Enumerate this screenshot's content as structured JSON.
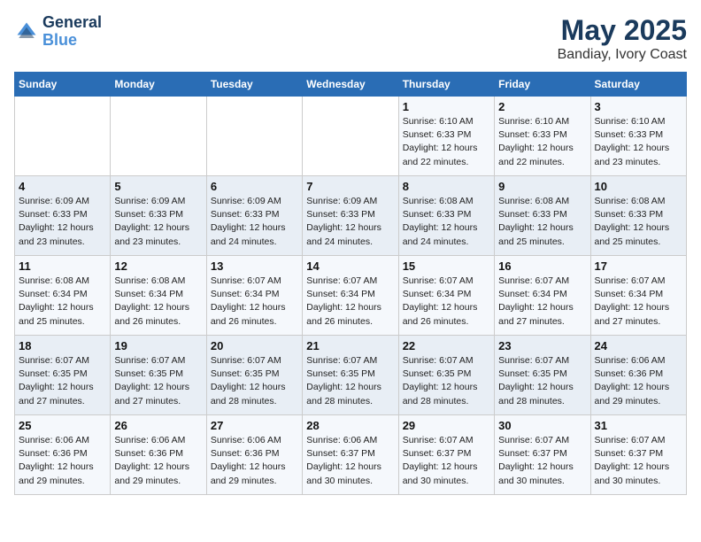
{
  "header": {
    "logo_line1": "General",
    "logo_line2": "Blue",
    "month_title": "May 2025",
    "location": "Bandiay, Ivory Coast"
  },
  "weekdays": [
    "Sunday",
    "Monday",
    "Tuesday",
    "Wednesday",
    "Thursday",
    "Friday",
    "Saturday"
  ],
  "weeks": [
    [
      {
        "day": "",
        "info": ""
      },
      {
        "day": "",
        "info": ""
      },
      {
        "day": "",
        "info": ""
      },
      {
        "day": "",
        "info": ""
      },
      {
        "day": "1",
        "info": "Sunrise: 6:10 AM\nSunset: 6:33 PM\nDaylight: 12 hours\nand 22 minutes."
      },
      {
        "day": "2",
        "info": "Sunrise: 6:10 AM\nSunset: 6:33 PM\nDaylight: 12 hours\nand 22 minutes."
      },
      {
        "day": "3",
        "info": "Sunrise: 6:10 AM\nSunset: 6:33 PM\nDaylight: 12 hours\nand 23 minutes."
      }
    ],
    [
      {
        "day": "4",
        "info": "Sunrise: 6:09 AM\nSunset: 6:33 PM\nDaylight: 12 hours\nand 23 minutes."
      },
      {
        "day": "5",
        "info": "Sunrise: 6:09 AM\nSunset: 6:33 PM\nDaylight: 12 hours\nand 23 minutes."
      },
      {
        "day": "6",
        "info": "Sunrise: 6:09 AM\nSunset: 6:33 PM\nDaylight: 12 hours\nand 24 minutes."
      },
      {
        "day": "7",
        "info": "Sunrise: 6:09 AM\nSunset: 6:33 PM\nDaylight: 12 hours\nand 24 minutes."
      },
      {
        "day": "8",
        "info": "Sunrise: 6:08 AM\nSunset: 6:33 PM\nDaylight: 12 hours\nand 24 minutes."
      },
      {
        "day": "9",
        "info": "Sunrise: 6:08 AM\nSunset: 6:33 PM\nDaylight: 12 hours\nand 25 minutes."
      },
      {
        "day": "10",
        "info": "Sunrise: 6:08 AM\nSunset: 6:33 PM\nDaylight: 12 hours\nand 25 minutes."
      }
    ],
    [
      {
        "day": "11",
        "info": "Sunrise: 6:08 AM\nSunset: 6:34 PM\nDaylight: 12 hours\nand 25 minutes."
      },
      {
        "day": "12",
        "info": "Sunrise: 6:08 AM\nSunset: 6:34 PM\nDaylight: 12 hours\nand 26 minutes."
      },
      {
        "day": "13",
        "info": "Sunrise: 6:07 AM\nSunset: 6:34 PM\nDaylight: 12 hours\nand 26 minutes."
      },
      {
        "day": "14",
        "info": "Sunrise: 6:07 AM\nSunset: 6:34 PM\nDaylight: 12 hours\nand 26 minutes."
      },
      {
        "day": "15",
        "info": "Sunrise: 6:07 AM\nSunset: 6:34 PM\nDaylight: 12 hours\nand 26 minutes."
      },
      {
        "day": "16",
        "info": "Sunrise: 6:07 AM\nSunset: 6:34 PM\nDaylight: 12 hours\nand 27 minutes."
      },
      {
        "day": "17",
        "info": "Sunrise: 6:07 AM\nSunset: 6:34 PM\nDaylight: 12 hours\nand 27 minutes."
      }
    ],
    [
      {
        "day": "18",
        "info": "Sunrise: 6:07 AM\nSunset: 6:35 PM\nDaylight: 12 hours\nand 27 minutes."
      },
      {
        "day": "19",
        "info": "Sunrise: 6:07 AM\nSunset: 6:35 PM\nDaylight: 12 hours\nand 27 minutes."
      },
      {
        "day": "20",
        "info": "Sunrise: 6:07 AM\nSunset: 6:35 PM\nDaylight: 12 hours\nand 28 minutes."
      },
      {
        "day": "21",
        "info": "Sunrise: 6:07 AM\nSunset: 6:35 PM\nDaylight: 12 hours\nand 28 minutes."
      },
      {
        "day": "22",
        "info": "Sunrise: 6:07 AM\nSunset: 6:35 PM\nDaylight: 12 hours\nand 28 minutes."
      },
      {
        "day": "23",
        "info": "Sunrise: 6:07 AM\nSunset: 6:35 PM\nDaylight: 12 hours\nand 28 minutes."
      },
      {
        "day": "24",
        "info": "Sunrise: 6:06 AM\nSunset: 6:36 PM\nDaylight: 12 hours\nand 29 minutes."
      }
    ],
    [
      {
        "day": "25",
        "info": "Sunrise: 6:06 AM\nSunset: 6:36 PM\nDaylight: 12 hours\nand 29 minutes."
      },
      {
        "day": "26",
        "info": "Sunrise: 6:06 AM\nSunset: 6:36 PM\nDaylight: 12 hours\nand 29 minutes."
      },
      {
        "day": "27",
        "info": "Sunrise: 6:06 AM\nSunset: 6:36 PM\nDaylight: 12 hours\nand 29 minutes."
      },
      {
        "day": "28",
        "info": "Sunrise: 6:06 AM\nSunset: 6:37 PM\nDaylight: 12 hours\nand 30 minutes."
      },
      {
        "day": "29",
        "info": "Sunrise: 6:07 AM\nSunset: 6:37 PM\nDaylight: 12 hours\nand 30 minutes."
      },
      {
        "day": "30",
        "info": "Sunrise: 6:07 AM\nSunset: 6:37 PM\nDaylight: 12 hours\nand 30 minutes."
      },
      {
        "day": "31",
        "info": "Sunrise: 6:07 AM\nSunset: 6:37 PM\nDaylight: 12 hours\nand 30 minutes."
      }
    ]
  ]
}
